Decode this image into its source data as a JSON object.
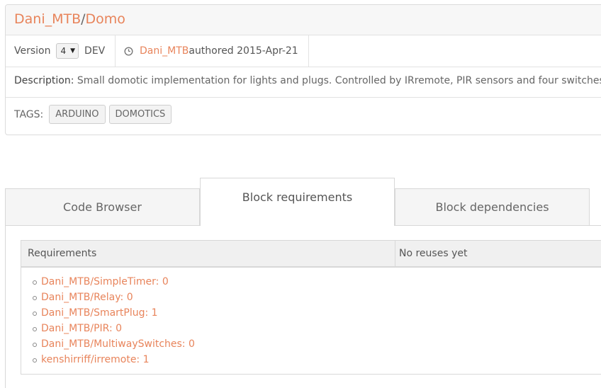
{
  "header": {
    "owner": "Dani_MTB",
    "separator": "/",
    "block_name": "Domo"
  },
  "meta": {
    "version_label": "Version",
    "version_value": "4",
    "branch": "DEV",
    "author": "Dani_MTB",
    "authored_text": " authored 2015-Apr-21"
  },
  "description": {
    "label": "Description:",
    "text": " Small domotic implementation for lights and plugs. Controlled by IRremote, PIR sensors and four switches"
  },
  "tags": {
    "label": "TAGS:",
    "items": [
      "ARDUINO",
      "DOMOTICS"
    ]
  },
  "tabs": {
    "code_browser": "Code Browser",
    "block_requirements": "Block requirements",
    "block_dependencies": "Block dependencies",
    "active": "block_requirements"
  },
  "requirements_table": {
    "col_requirements": "Requirements",
    "col_reuses": "No reuses yet",
    "items": [
      "Dani_MTB/SimpleTimer: 0",
      "Dani_MTB/Relay: 0",
      "Dani_MTB/SmartPlug: 1",
      "Dani_MTB/PIR: 0",
      "Dani_MTB/MultiwaySwitches: 0",
      "kenshirriff/irremote: 1"
    ]
  },
  "colors": {
    "link": "#e8845b",
    "text": "#555555",
    "border": "#dcdcdc",
    "header_bg": "#f7f7f7"
  },
  "icons": {
    "author": "clock-icon",
    "version_dropdown": "caret-down-icon"
  }
}
